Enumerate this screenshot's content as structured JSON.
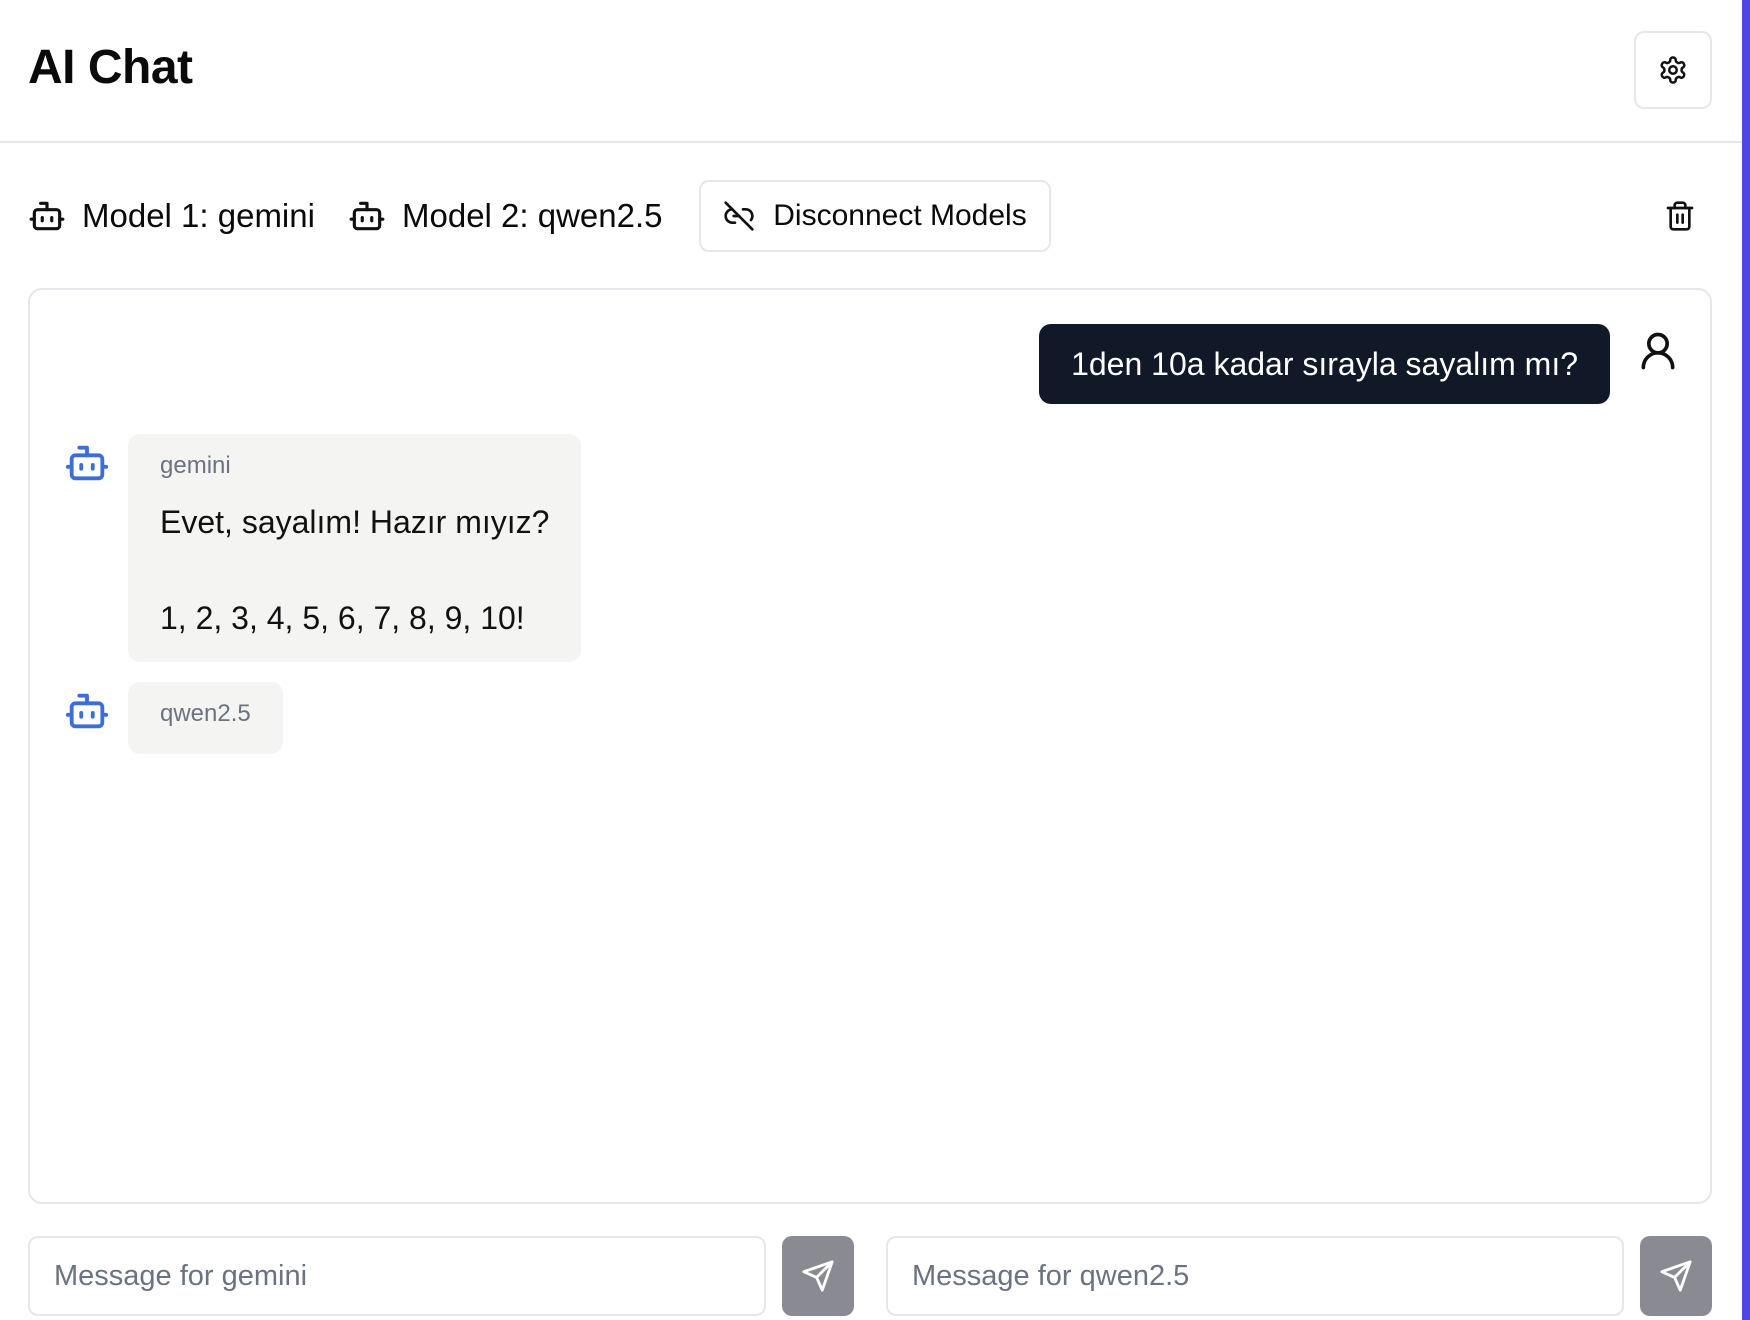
{
  "header": {
    "title": "AI Chat",
    "settings_icon": "gear-icon"
  },
  "models": {
    "model_1_label": "Model 1: gemini",
    "model_2_label": "Model 2: qwen2.5",
    "disconnect_label": "Disconnect Models",
    "disconnect_icon": "unlink-icon",
    "clear_icon": "trash-icon"
  },
  "chat": {
    "messages": [
      {
        "role": "user",
        "text": "1den 10a kadar sırayla sayalım mı?"
      },
      {
        "role": "assistant",
        "name": "gemini",
        "text": "Evet, sayalım! Hazır mıyız?\n\n1, 2, 3, 4, 5, 6, 7, 8, 9, 10!"
      },
      {
        "role": "assistant",
        "name": "qwen2.5",
        "text": ""
      }
    ]
  },
  "inputs": {
    "model_1_placeholder": "Message for gemini",
    "model_2_placeholder": "Message for qwen2.5",
    "send_icon": "send-icon"
  },
  "colors": {
    "user_bubble": "#111827",
    "assistant_bubble": "#f4f4f3",
    "bot_icon": "#3b6fd8",
    "send_button": "#8a8a93",
    "accent_edge": "#4f46e5"
  }
}
